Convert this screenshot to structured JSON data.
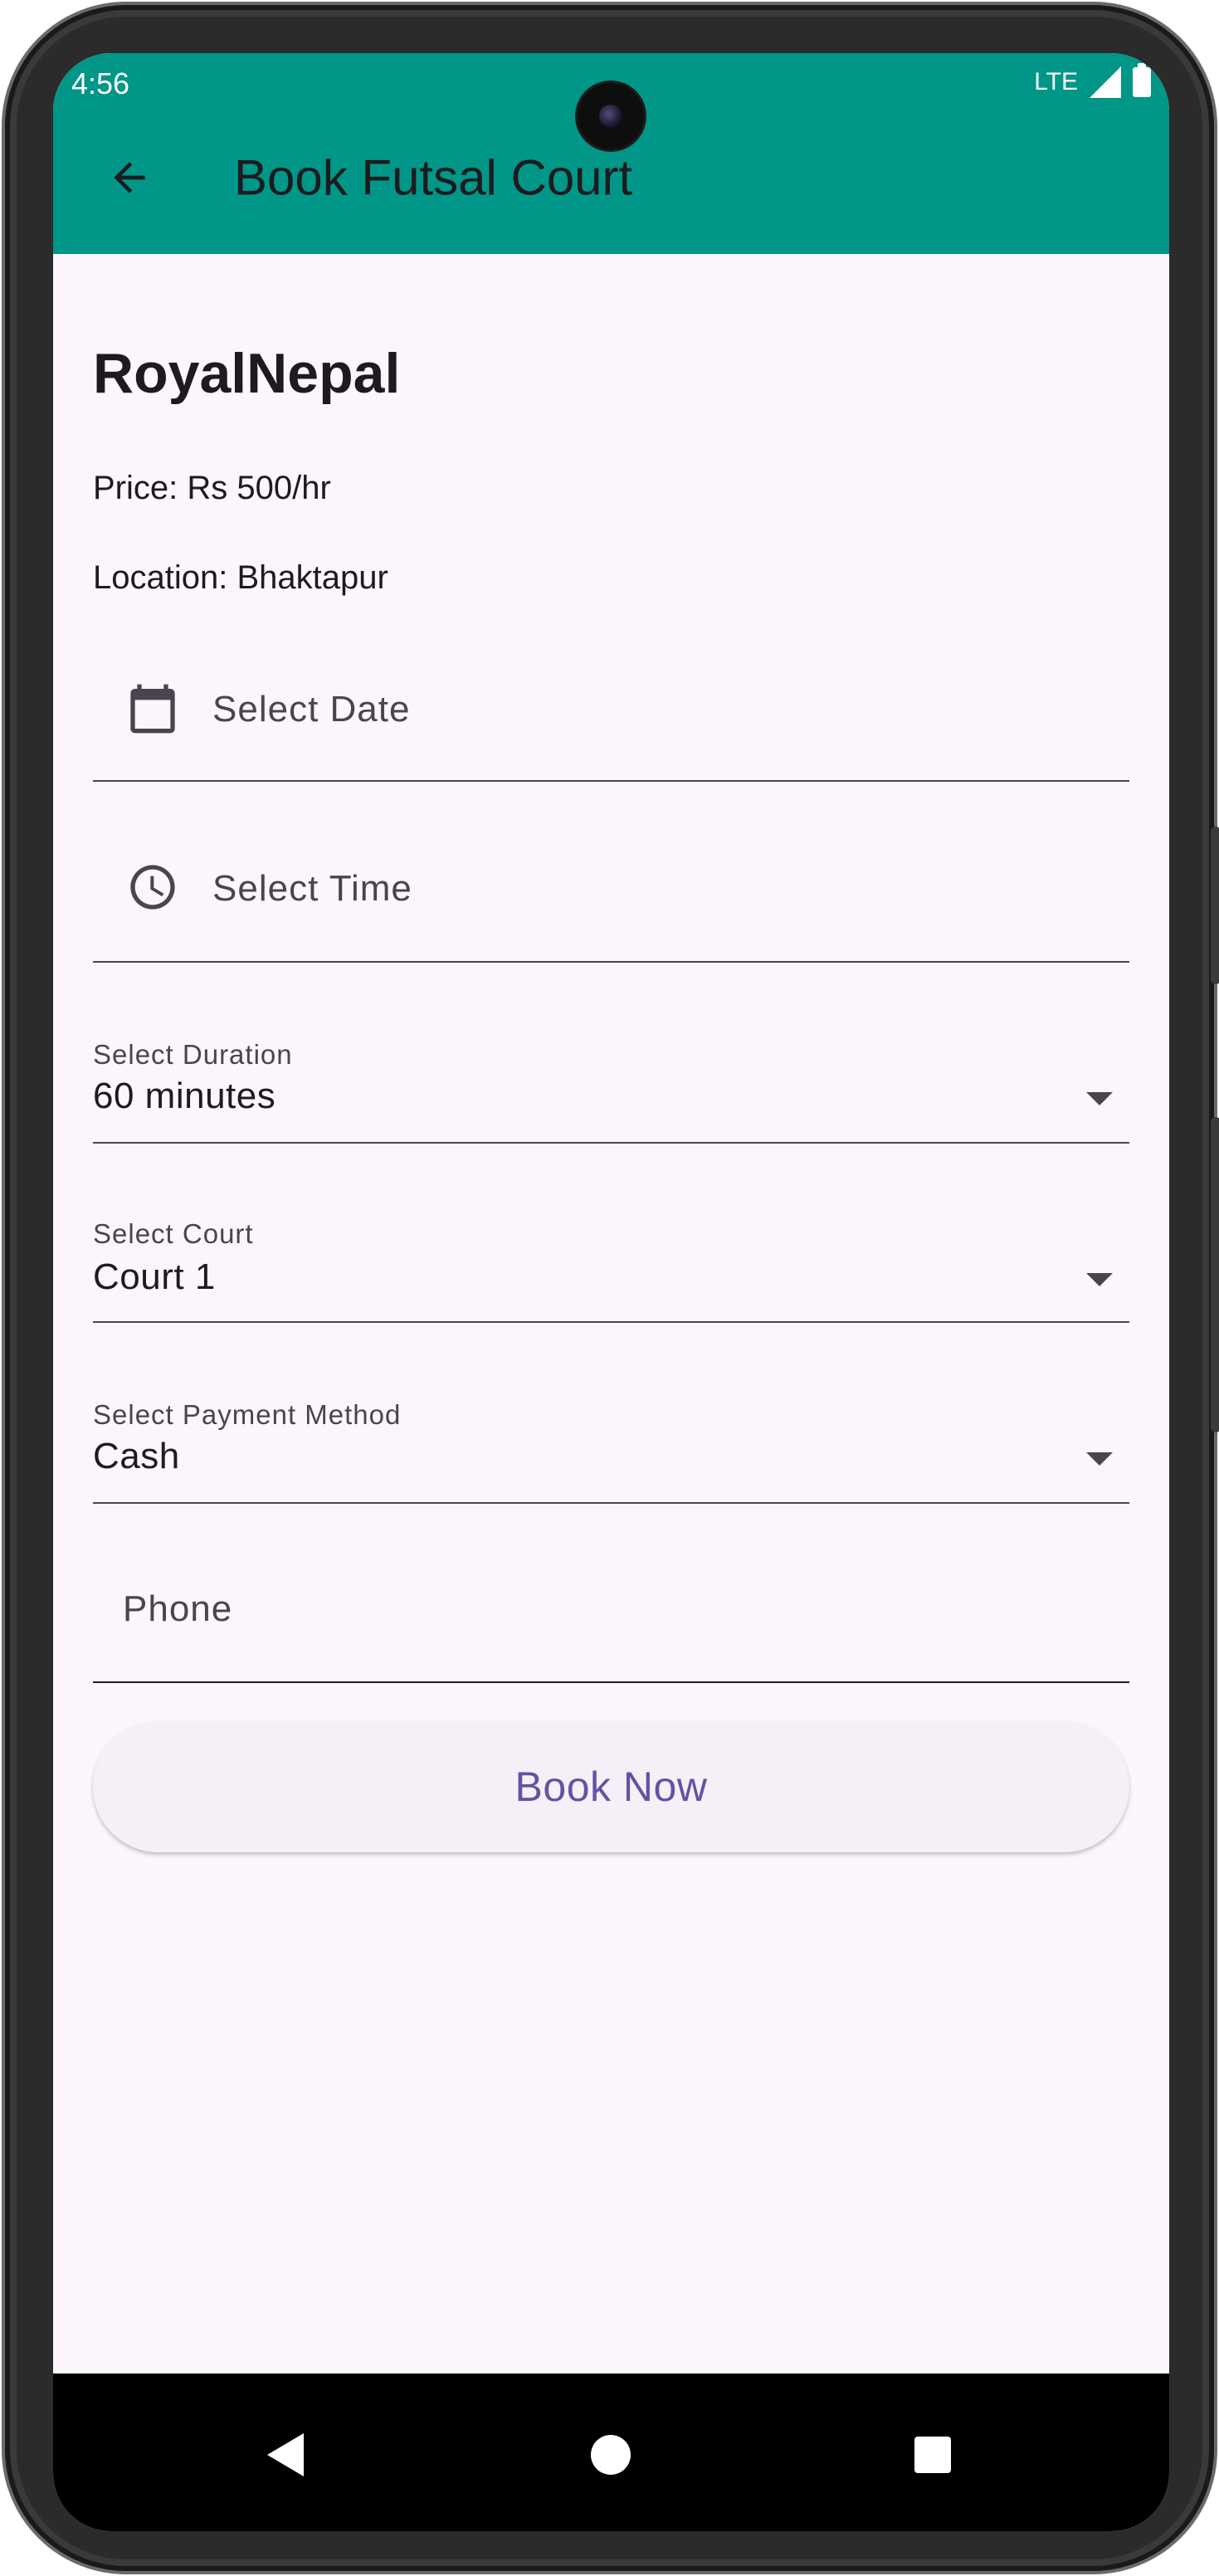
{
  "status_bar": {
    "time": "4:56",
    "network": "LTE",
    "icons": [
      "signal-icon",
      "battery-icon"
    ]
  },
  "app_bar": {
    "title": "Book Futsal Court",
    "back_icon": "arrow-back-icon",
    "color": "#009688"
  },
  "court": {
    "name": "RoyalNepal",
    "price": "Price: Rs 500/hr",
    "location": "Location: Bhaktapur"
  },
  "form": {
    "date": {
      "hint": "Select Date",
      "icon": "calendar-icon"
    },
    "time": {
      "hint": "Select Time",
      "icon": "clock-icon"
    },
    "duration": {
      "label": "Select Duration",
      "value": "60 minutes",
      "icon": "dropdown-arrow-icon"
    },
    "court": {
      "label": "Select Court",
      "value": "Court 1",
      "icon": "dropdown-arrow-icon"
    },
    "payment": {
      "label": "Select Payment Method",
      "value": "Cash",
      "icon": "dropdown-arrow-icon"
    },
    "phone": {
      "hint": "Phone"
    },
    "submit_label": "Book Now"
  },
  "colors": {
    "accent": "#6750a4",
    "background": "#fcf5fb",
    "app_bar": "#009688"
  },
  "nav_bar": {
    "icons": [
      "nav-back-icon",
      "nav-home-icon",
      "nav-recents-icon"
    ]
  }
}
